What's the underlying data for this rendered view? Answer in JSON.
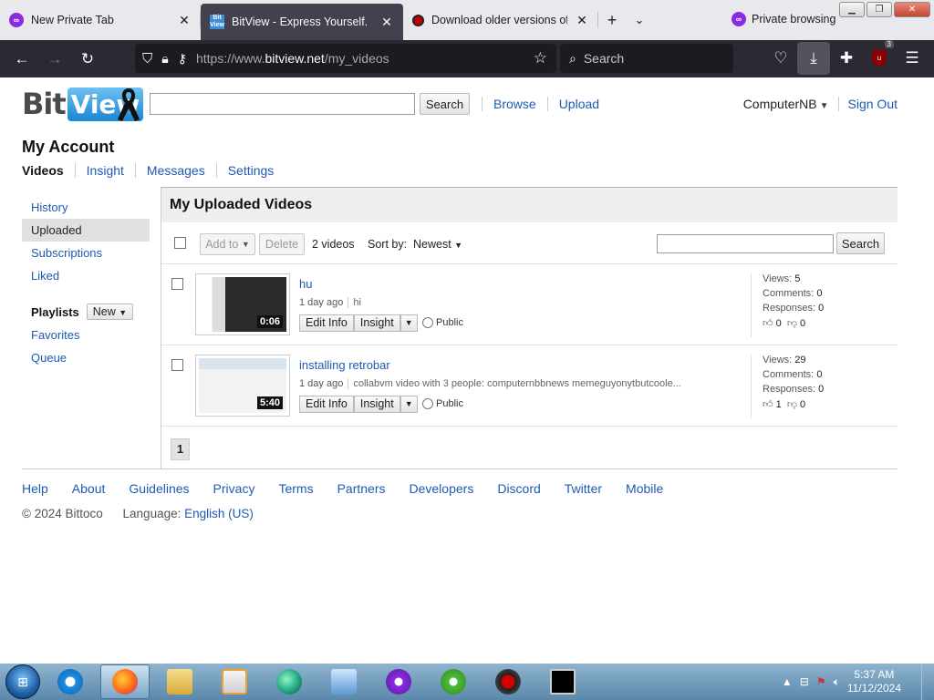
{
  "browser": {
    "tabs": [
      {
        "label": "New Private Tab",
        "icon": "private-mask-icon"
      },
      {
        "label": "BitView - Express Yourself.",
        "icon": "bitview-favicon"
      },
      {
        "label": "Download older versions of Bar",
        "icon": "record-icon"
      }
    ],
    "private_label": "Private browsing",
    "url_prefix": "https://www.",
    "url_domain": "bitview.net",
    "url_path": "/my_videos",
    "search_placeholder": "Search",
    "extension_badge": "3"
  },
  "site": {
    "logo_bit": "Bit",
    "logo_view": "View",
    "search_button": "Search",
    "nav": [
      "Browse",
      "Upload"
    ],
    "username": "ComputerNB",
    "sign_out": "Sign Out"
  },
  "account": {
    "title": "My Account",
    "tabs": [
      "Videos",
      "Insight",
      "Messages",
      "Settings"
    ]
  },
  "sidebar": {
    "items": [
      "History",
      "Uploaded",
      "Subscriptions",
      "Liked"
    ],
    "active": "Uploaded",
    "playlists_label": "Playlists",
    "new_button": "New",
    "playlist_items": [
      "Favorites",
      "Queue"
    ]
  },
  "main": {
    "heading": "My Uploaded Videos",
    "add_to": "Add to",
    "delete": "Delete",
    "count": "2 videos",
    "sort_label": "Sort by:",
    "sort_value": "Newest",
    "search_button": "Search",
    "page": "1"
  },
  "videos": [
    {
      "title": "hu",
      "age": "1 day ago",
      "description": "hi",
      "duration": "0:06",
      "edit": "Edit Info",
      "insight": "Insight",
      "privacy": "Public",
      "views_label": "Views:",
      "views": "5",
      "comments_label": "Comments:",
      "comments": "0",
      "responses_label": "Responses:",
      "responses": "0",
      "likes": "0",
      "dislikes": "0"
    },
    {
      "title": "installing retrobar",
      "age": "1 day ago",
      "description": "collabvm video with 3 people: computernbbnews memeguyonytbutcoole...",
      "duration": "5:40",
      "edit": "Edit Info",
      "insight": "Insight",
      "privacy": "Public",
      "views_label": "Views:",
      "views": "29",
      "comments_label": "Comments:",
      "comments": "0",
      "responses_label": "Responses:",
      "responses": "0",
      "likes": "1",
      "dislikes": "0"
    }
  ],
  "footer": {
    "links": [
      "Help",
      "About",
      "Guidelines",
      "Privacy",
      "Terms",
      "Partners",
      "Developers",
      "Discord",
      "Twitter",
      "Mobile"
    ],
    "copyright": "© 2024 Bittoco",
    "language_label": "Language:",
    "language_value": "English (US)"
  },
  "taskbar": {
    "apps": [
      "internet-explorer-icon",
      "firefox-icon",
      "file-explorer-icon",
      "media-player-icon",
      "retrobar-icon",
      "control-panel-icon",
      "private-browser-icon",
      "utorrent-icon",
      "recorder-icon",
      "command-prompt-icon"
    ],
    "time": "5:37 AM",
    "date": "11/12/2024"
  }
}
